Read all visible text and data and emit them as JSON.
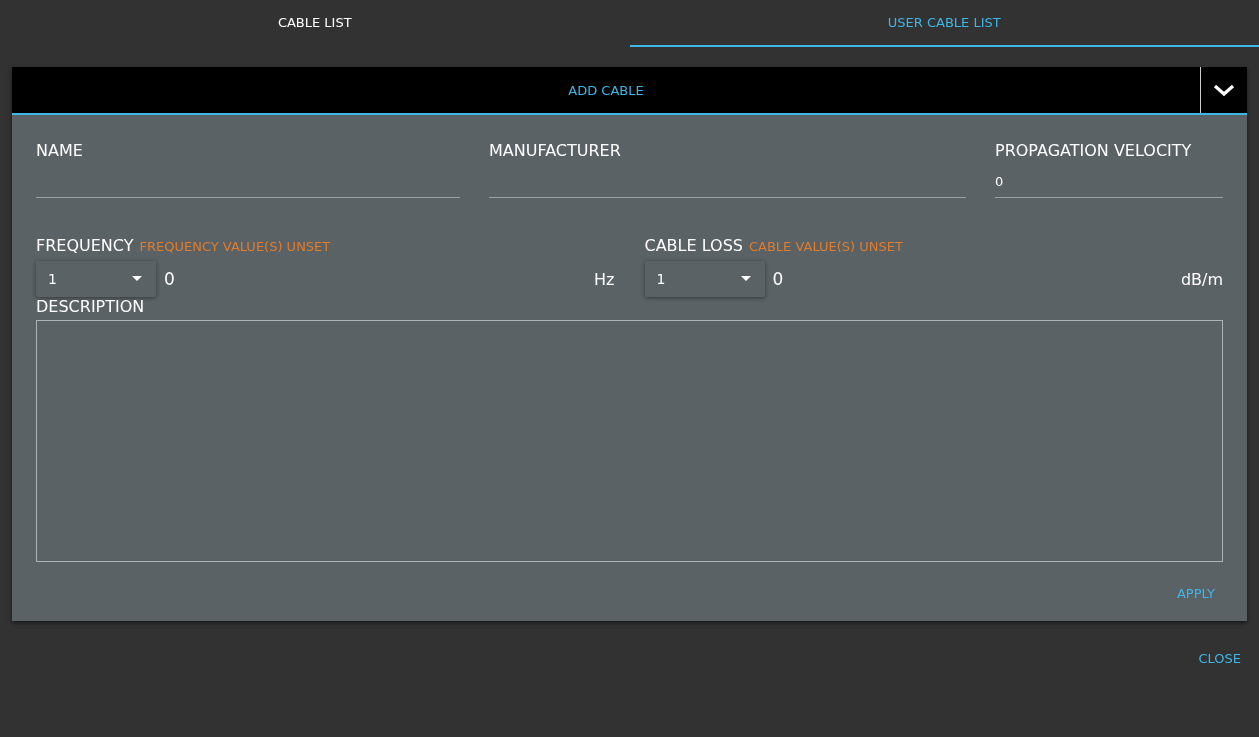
{
  "tabs": [
    {
      "label": "CABLE LIST",
      "selected": false
    },
    {
      "label": "USER CABLE LIST",
      "selected": true
    }
  ],
  "panel": {
    "title": "ADD CABLE",
    "fields": [
      {
        "label": "NAME"
      },
      {
        "label": "MANUFACTURER"
      },
      {
        "label": "PROPAGATION VELOCITY",
        "value": "0"
      }
    ],
    "tables": [
      {
        "label": "FREQUENCY",
        "warning": "FREQUENCY VALUE(S) UNSET",
        "index": "1",
        "value": "0",
        "unit": "Hz"
      },
      {
        "label": "CABLE LOSS",
        "warning": "CABLE VALUE(S) UNSET",
        "index": "1",
        "value": "0",
        "unit": "dB/m"
      }
    ],
    "description": {
      "label": "DESCRIPTION"
    },
    "apply": "APPLY"
  },
  "close": "CLOSE"
}
